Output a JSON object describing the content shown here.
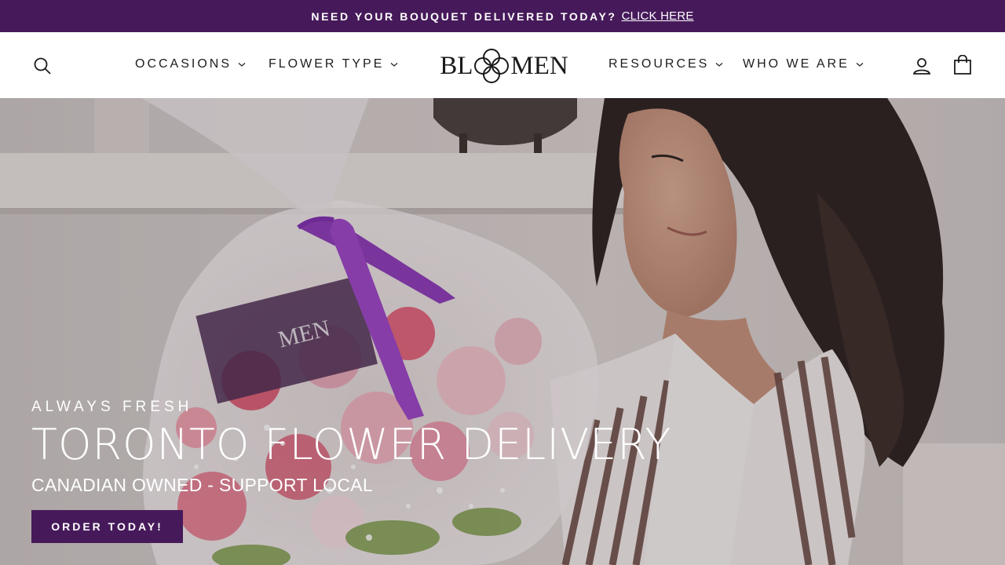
{
  "colors": {
    "brand": "#461a5a",
    "text": "#1c1d1d",
    "hero_text": "#ffffff"
  },
  "announcement": {
    "text": "NEED YOUR BOUQUET DELIVERED TODAY?",
    "link": "CLICK HERE"
  },
  "header": {
    "logo_left": "BL",
    "logo_right": "MEN",
    "nav_left": [
      {
        "label": "OCCASIONS",
        "icon": "chevron-down-icon"
      },
      {
        "label": "FLOWER TYPE",
        "icon": "chevron-down-icon"
      }
    ],
    "nav_right": [
      {
        "label": "RESOURCES",
        "icon": "chevron-down-icon"
      },
      {
        "label": "WHO WE ARE",
        "icon": "chevron-down-icon"
      }
    ],
    "icons": [
      "search-icon",
      "account-icon",
      "cart-bag-icon"
    ]
  },
  "hero": {
    "eyebrow": "ALWAYS FRESH",
    "headline": "TORONTO FLOWER DELIVERY",
    "subline": "CANADIAN OWNED - SUPPORT LOCAL",
    "cta": "ORDER TODAY!",
    "card_text": "MEN"
  }
}
